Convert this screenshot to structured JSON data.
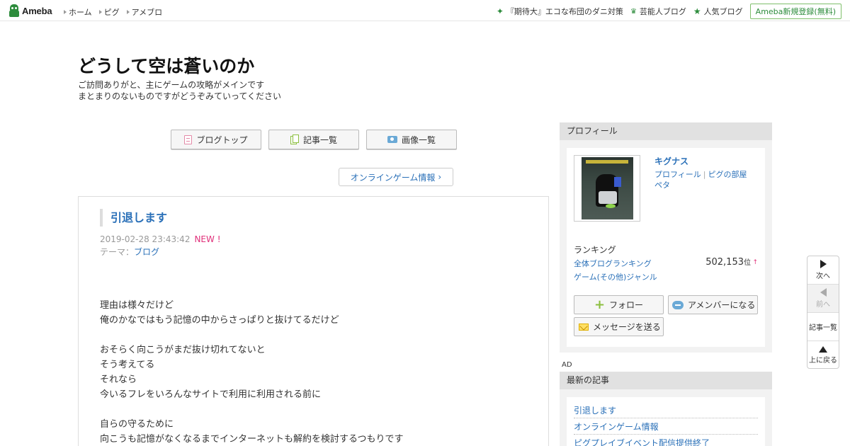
{
  "topbar": {
    "logo_text": "Ameba",
    "nav": [
      "ホーム",
      "ピグ",
      "アメブロ"
    ],
    "right_links": [
      {
        "label": "『期待大』エコな布団のダニ対策",
        "icon": "sparkle-icon"
      },
      {
        "label": "芸能人ブログ",
        "icon": "crown-icon"
      },
      {
        "label": "人気ブログ",
        "icon": "star-icon"
      }
    ],
    "signup_label": "Ameba新規登録(無料)"
  },
  "header": {
    "title": "どうして空は蒼いのか",
    "description_lines": [
      "ご訪問ありがと、主にゲームの攻略がメインです",
      "まとまりのないものですがどうぞみていってください"
    ]
  },
  "nav_buttons": {
    "blog_top": "ブログトップ",
    "entry_list": "記事一覧",
    "image_list": "画像一覧"
  },
  "theme_button": "オンラインゲーム情報",
  "entry": {
    "title": "引退します",
    "date": "2019-02-28 23:43:42",
    "new_badge": "NEW !",
    "theme_prefix": "テーマ：",
    "theme": "ブログ",
    "paragraphs": [
      [
        "理由は様々だけど",
        "俺のかなではもう記憶の中からさっぱりと抜けてるだけど"
      ],
      [
        "おそらく向こうがまだ抜け切れてないと",
        "そう考えてる",
        "それなら",
        "今いるフレをいろんなサイトで利用に利用される前に"
      ],
      [
        "自らの守るために",
        "向こうも記憶がなくなるまでインターネットも解約を検討するつもりです"
      ]
    ]
  },
  "profile": {
    "heading": "プロフィール",
    "name": "キグナス",
    "link_profile": "プロフィール",
    "separator": "|",
    "link_pig_room": "ピグの部屋",
    "link_peta": "ペタ",
    "ranking_label": "ランキング",
    "ranking_overall": "全体ブログランキング",
    "ranking_genre": "ゲーム(その他)ジャンル",
    "rank_value": "502,153",
    "rank_unit": "位",
    "rank_arrow": "↑",
    "follow_label": "フォロー",
    "amember_label": "アメンバーになる",
    "message_label": "メッセージを送る"
  },
  "ad_label": "AD",
  "latest": {
    "heading": "最新の記事",
    "items": [
      "引退します",
      "オンラインゲーム情報",
      "ピグプレイブイベント配信提供終了"
    ]
  },
  "pager": {
    "next": "次へ",
    "prev": "前へ",
    "list": "記事一覧",
    "top": "上に戻る"
  },
  "colors": {
    "brand_green": "#2d8c3c",
    "link_blue": "#2a70b8",
    "new_pink": "#e0307a"
  }
}
